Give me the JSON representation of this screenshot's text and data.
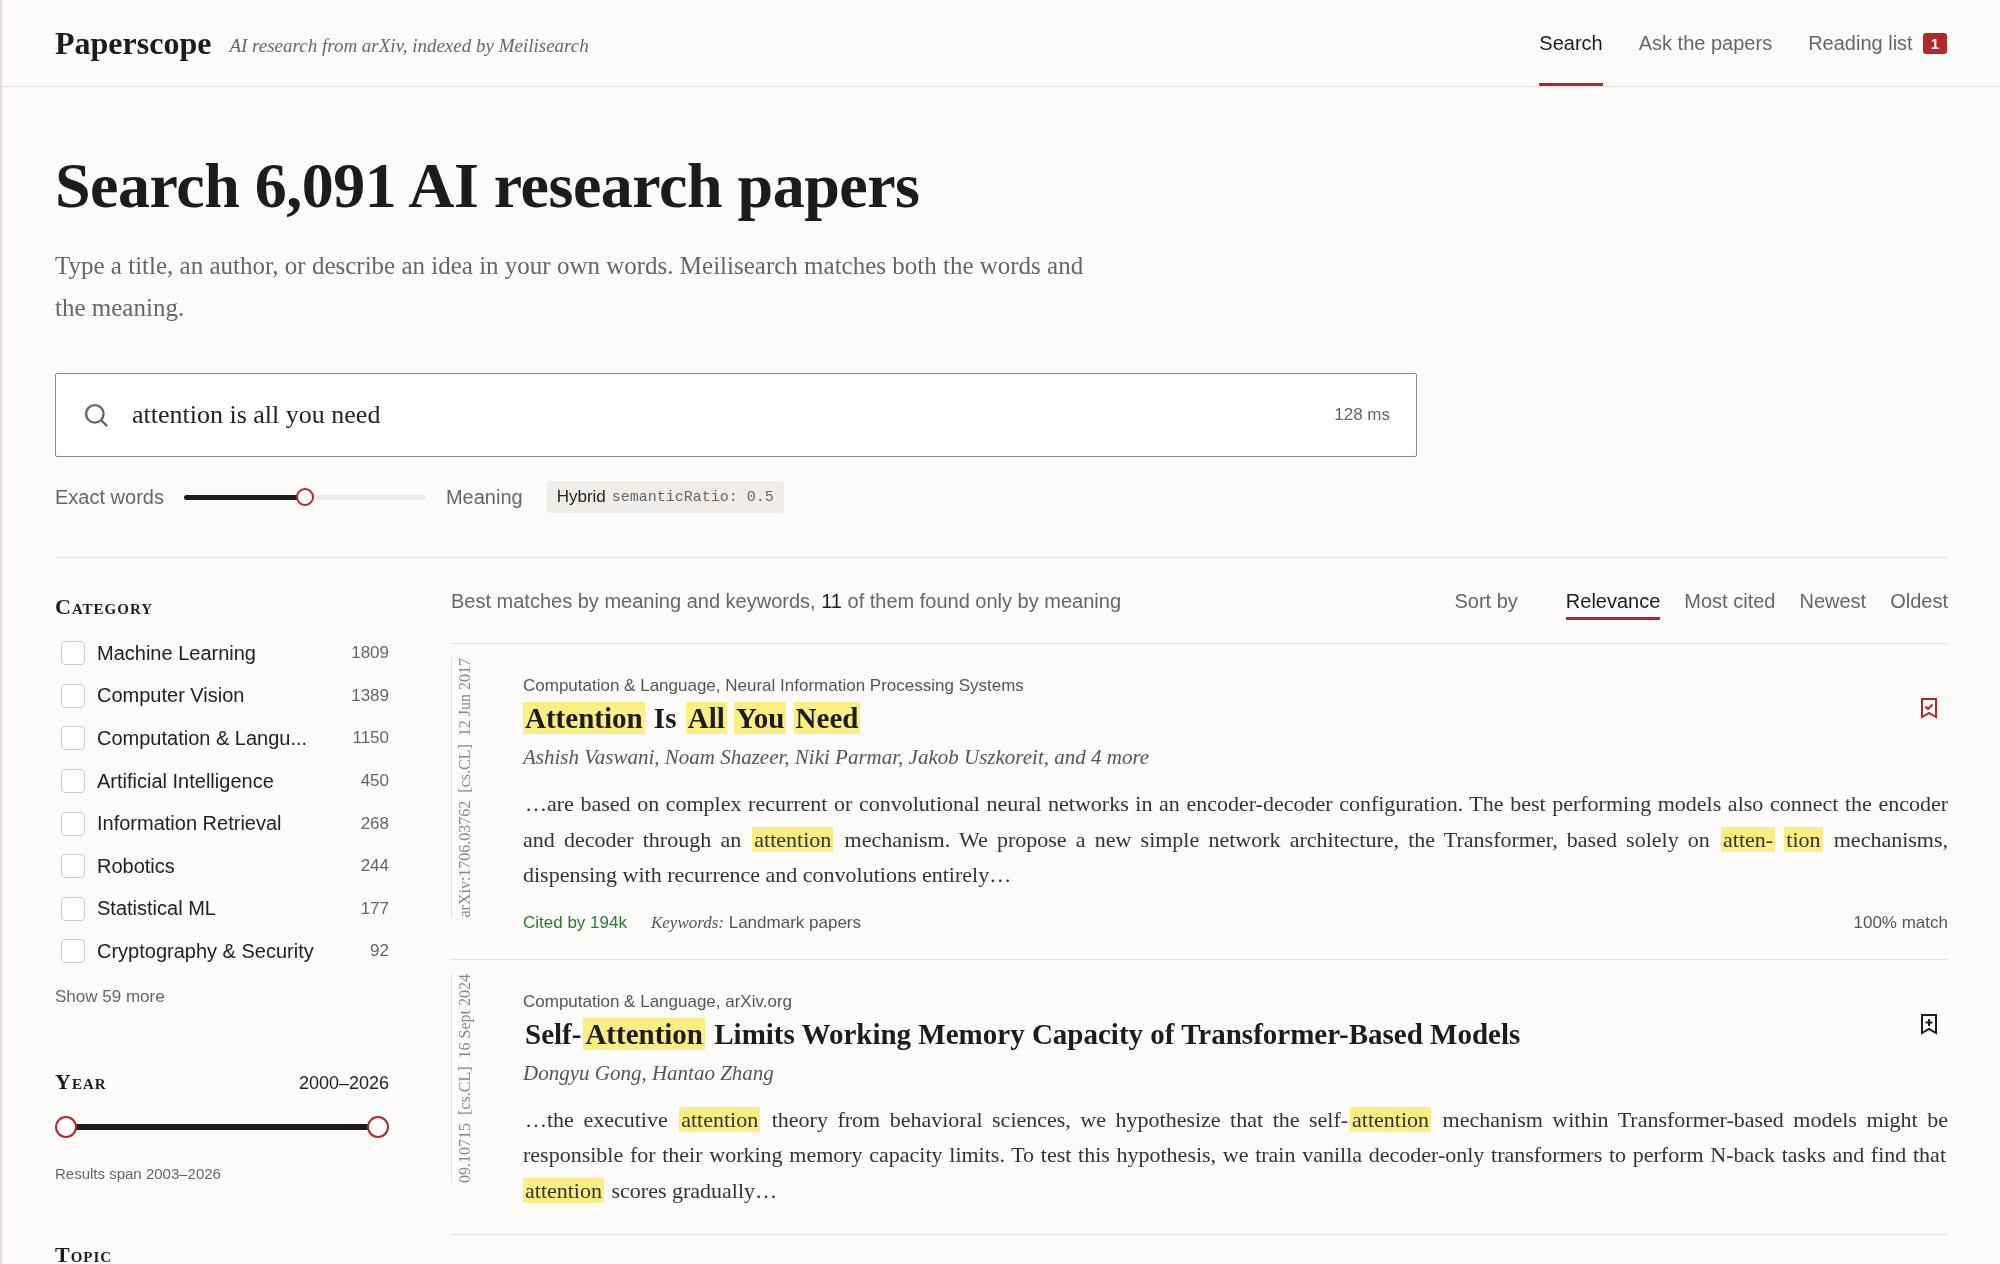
{
  "header": {
    "logo": "Paperscope",
    "tagline": "AI research from arXiv, indexed by Meilisearch",
    "nav": [
      {
        "label": "Search",
        "selected": true
      },
      {
        "label": "Ask the papers",
        "selected": false
      },
      {
        "label": "Reading list",
        "selected": false,
        "badge": "1"
      }
    ]
  },
  "hero": {
    "title": "Search 6,091 AI research papers",
    "subtitle": "Type a title, an author, or describe an idea in your own words. Meilisearch matches both the words and the meaning."
  },
  "search": {
    "value": "attention is all you need",
    "timing": "128 ms"
  },
  "ratio": {
    "left_label": "Exact words",
    "right_label": "Meaning",
    "level": 0.5,
    "mode": "Hybrid",
    "code": "semanticRatio: 0.5"
  },
  "sidebar": {
    "category": {
      "title": "Category",
      "items": [
        {
          "label": "Machine Learning",
          "count": "1809",
          "checked": false
        },
        {
          "label": "Computer Vision",
          "count": "1389",
          "checked": false
        },
        {
          "label": "Computation & Langu...",
          "count": "1150",
          "checked": false
        },
        {
          "label": "Artificial Intelligence",
          "count": "450",
          "checked": false
        },
        {
          "label": "Information Retrieval",
          "count": "268",
          "checked": false
        },
        {
          "label": "Robotics",
          "count": "244",
          "checked": false
        },
        {
          "label": "Statistical ML",
          "count": "177",
          "checked": false
        },
        {
          "label": "Cryptography & Security",
          "count": "92",
          "checked": false
        }
      ],
      "more": "Show 59 more"
    },
    "year": {
      "title": "Year",
      "range": "2000–2026",
      "low": {
        "level": 0
      },
      "high": {
        "level": 1
      },
      "note": "Results span 2003–2026"
    },
    "topic": {
      "title": "Topic"
    }
  },
  "results": {
    "summary": "Best matches by meaning and keywords, **11** of them found only by meaning",
    "sort_label": "Sort by",
    "sort": [
      {
        "label": "Relevance",
        "selected": true
      },
      {
        "label": "Most cited",
        "selected": false
      },
      {
        "label": "Newest",
        "selected": false
      },
      {
        "label": "Oldest",
        "selected": false
      }
    ],
    "items": [
      {
        "side": "arXiv:1706.03762  [cs.CL]  12 Jun 2017",
        "venue": "Computation & Language, Neural Information Processing Systems",
        "saved": true,
        "title": [
          {
            "text": "Attention",
            "hl": true
          },
          {
            "text": "Is",
            "hl": false
          },
          {
            "text": "All",
            "hl": true
          },
          {
            "text": "You",
            "hl": true
          },
          {
            "text": "Need",
            "hl": true
          }
        ],
        "authors": "Ashish Vaswani, Noam Shazeer, Niki Parmar, Jakob Uszkoreit, and 4 more",
        "abstract": [
          {
            "text": "…are based on complex recurrent or convolutional neural networks in an encoder-decoder configuration. The best performing models also connect the encoder and decoder through an",
            "hl": false
          },
          {
            "text": "attention",
            "hl": true
          },
          {
            "text": "mechanism. We propose a new simple network architecture, the Transformer, based solely on",
            "hl": false
          },
          {
            "text": "atten-",
            "hl": true
          },
          {
            "text": "tion",
            "hl": true
          },
          {
            "text": "mechanisms, dispensing with recurrence and convolutions entirely…",
            "hl": false
          }
        ],
        "cited": "Cited by 194k",
        "keywords": "*Keywords:* Landmark papers",
        "match": "100% match"
      },
      {
        "side": "09.10715  [cs.CL]  16 Sept 2024",
        "venue": "Computation & Language, arXiv.org",
        "saved": false,
        "title": [
          {
            "text": "Self-",
            "hl": false,
            "glue": true
          },
          {
            "text": "Attention",
            "hl": true
          },
          {
            "text": "Limits Working Memory Capacity of Transformer-Based Models",
            "hl": false
          }
        ],
        "authors": "Dongyu Gong, Hantao Zhang",
        "abstract": [
          {
            "text": "…the executive",
            "hl": false
          },
          {
            "text": "attention",
            "hl": true
          },
          {
            "text": "theory from behavioral sciences, we hypothesize that the self-",
            "hl": false,
            "glue": true
          },
          {
            "text": "attention",
            "hl": true
          },
          {
            "text": "mechanism within Transformer-based models might be responsible for their working memory capacity limits. To test this hypothesis, we train vanilla decoder-only transformers to perform N-back tasks and find that",
            "hl": false
          },
          {
            "text": "attention",
            "hl": true
          },
          {
            "text": "scores gradually…",
            "hl": false
          }
        ]
      }
    ]
  }
}
